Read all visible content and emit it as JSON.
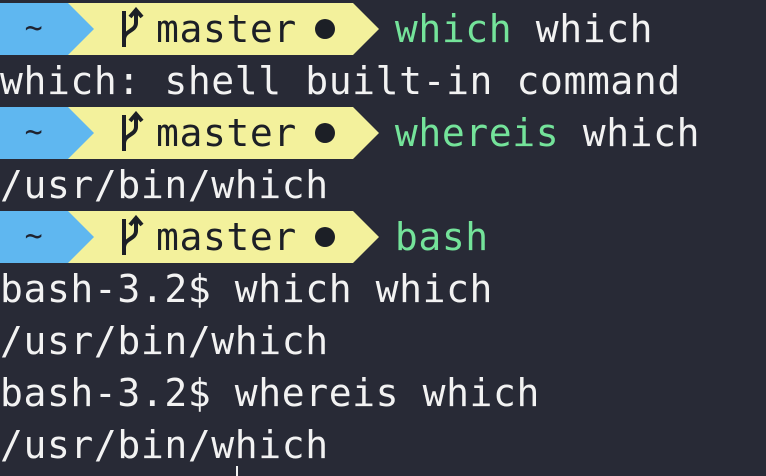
{
  "terminal": {
    "prompt_dir": "~",
    "prompt_branch": "master",
    "branch_icon": "git-branch-icon",
    "dirty_indicator": "dirty-dot-icon",
    "colors": {
      "background": "#282a36",
      "dir_segment": "#5fb7f0",
      "git_segment": "#f3f19c",
      "command": "#74e39a",
      "text": "#f2f2f2"
    },
    "lines": [
      {
        "type": "prompt",
        "command": "which",
        "args": "which"
      },
      {
        "type": "output",
        "text": "which: shell built-in command"
      },
      {
        "type": "prompt",
        "command": "whereis",
        "args": "which"
      },
      {
        "type": "output",
        "text": "/usr/bin/which"
      },
      {
        "type": "prompt",
        "command": "bash",
        "args": ""
      },
      {
        "type": "output",
        "text": "bash-3.2$ which which"
      },
      {
        "type": "output",
        "text": "/usr/bin/which"
      },
      {
        "type": "output",
        "text": "bash-3.2$ whereis which"
      },
      {
        "type": "output",
        "text": "/usr/bin/which"
      }
    ]
  }
}
